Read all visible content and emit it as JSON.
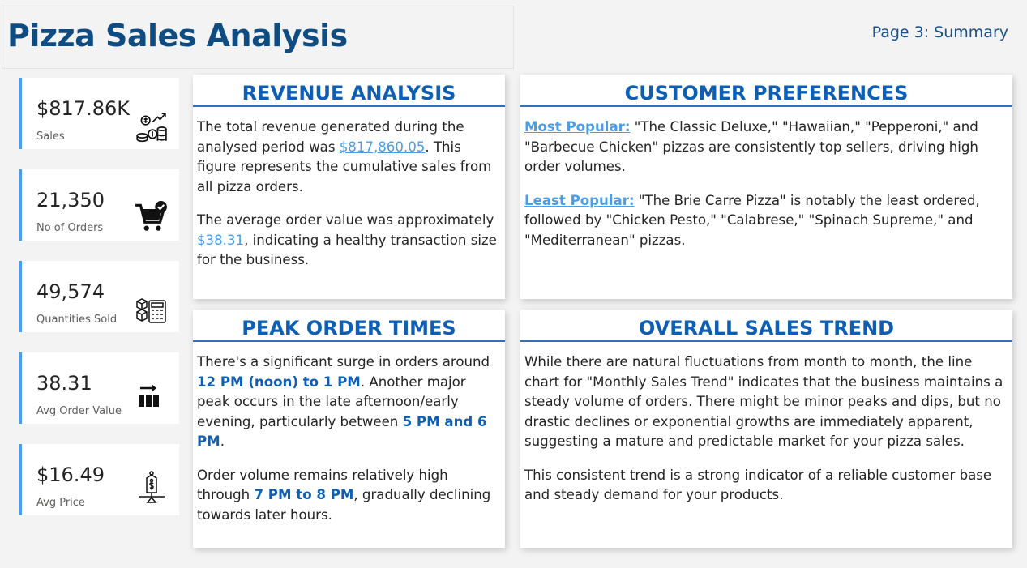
{
  "header": {
    "title": "Pizza Sales Analysis",
    "page_label": "Page 3: Summary"
  },
  "kpis": [
    {
      "value": "$817.86K",
      "label": "Sales",
      "icon": "money-growth-icon"
    },
    {
      "value": "21,350",
      "label": "No of Orders",
      "icon": "cart-check-icon"
    },
    {
      "value": "49,574",
      "label": "Quantities Sold",
      "icon": "boxes-calculator-icon"
    },
    {
      "value": "38.31",
      "label": "Avg Order Value",
      "icon": "bar-growth-icon"
    },
    {
      "value": "$16.49",
      "label": "Avg Price",
      "icon": "price-tag-balance-icon"
    }
  ],
  "revenue": {
    "heading": "REVENUE ANALYSIS",
    "p1_a": "The total revenue generated during the analysed period was ",
    "p1_link": "$817,860.05",
    "p1_b": ". This figure represents the cumulative sales from all pizza orders.",
    "p2_a": "The average order value was approximately ",
    "p2_link": "$38.31",
    "p2_b": ", indicating a healthy transaction size for the business."
  },
  "preferences": {
    "heading": "CUSTOMER PREFERENCES",
    "p1_label": "Most Popular:",
    "p1_text": " \"The Classic Deluxe,\" \"Hawaiian,\" \"Pepperoni,\" and \"Barbecue Chicken\" pizzas are consistently top sellers, driving high order volumes.",
    "p2_label": "Least Popular:",
    "p2_text": " \"The Brie Carre Pizza\" is notably the least ordered, followed by \"Chicken Pesto,\" \"Calabrese,\" \"Spinach Supreme,\" and \"Mediterranean\" pizzas."
  },
  "peak": {
    "heading": "PEAK ORDER TIMES",
    "p1_a": "There's a significant surge in orders around ",
    "p1_b1": "12 PM (noon) to 1 PM",
    "p1_c": ". Another major peak occurs in the late afternoon/early evening, particularly between ",
    "p1_b2": "5 PM and 6 PM",
    "p1_d": ".",
    "p2_a": "Order volume remains relatively high through ",
    "p2_b": "7 PM to 8 PM",
    "p2_c": ", gradually declining towards later hours."
  },
  "trend": {
    "heading": "OVERALL SALES TREND",
    "p1": "While there are natural fluctuations from month to month, the line chart for \"Monthly Sales Trend\" indicates that the business maintains a steady volume of orders. There might be minor peaks and dips, but no drastic declines or exponential growths are immediately apparent, suggesting a mature and predictable market for your pizza sales.",
    "p2": "This consistent trend is a strong indicator of a reliable customer base and steady demand for your products."
  },
  "colors": {
    "title": "#0f4c81",
    "heading": "#0e5fb4",
    "link": "#4a9ee8",
    "kpi_accent": "#4a9ee8"
  }
}
